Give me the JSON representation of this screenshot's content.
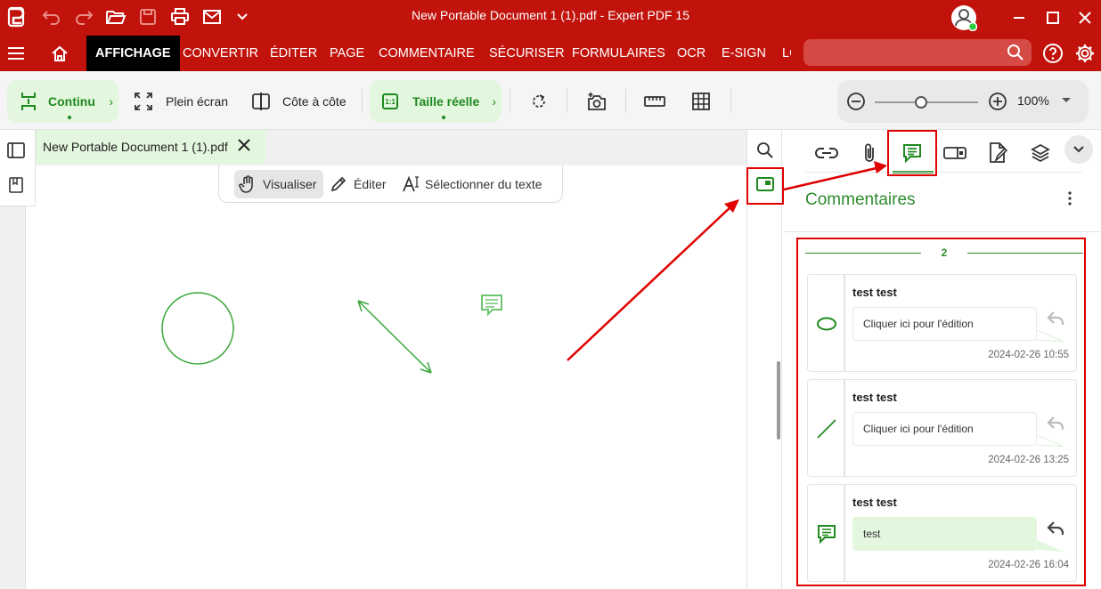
{
  "app": {
    "window_title": "New Portable Document 1 (1).pdf   -   Expert PDF 15"
  },
  "menu": {
    "items": [
      "AFFICHAGE",
      "CONVERTIR",
      "ÉDITER",
      "PAGE",
      "COMMENTAIRE",
      "SÉCURISER",
      "FORMULAIRES",
      "OCR",
      "E-SIGN",
      "LO"
    ],
    "active": "AFFICHAGE"
  },
  "toolbar": {
    "continu": "Continu",
    "plein_ecran": "Plein écran",
    "cote_a_cote": "Côte à côte",
    "taille_reelle": "Taille réelle",
    "taille_icon_text": "1:1",
    "zoom": "100%",
    "zoom_level": 0.45
  },
  "document": {
    "tab_title": "New Portable Document 1 (1).pdf",
    "modes": {
      "visualiser": "Visualiser",
      "editer": "Éditer",
      "selectionner": "Sélectionner du texte"
    }
  },
  "panel": {
    "title": "Commentaires",
    "count": "2",
    "comments": [
      {
        "author": "test test",
        "text": "Cliquer ici pour l'édition",
        "date": "2024-02-26 10:55",
        "type": "ellipse-icon"
      },
      {
        "author": "test test",
        "text": "Cliquer ici pour l'édition",
        "date": "2024-02-26 13:25",
        "type": "line-icon"
      },
      {
        "author": "test test",
        "text": "test",
        "date": "2024-02-26 16:04",
        "type": "note-icon"
      }
    ]
  },
  "colors": {
    "brand_red": "#c1120c",
    "accent_green": "#2e8b2e",
    "highlight_green": "#e3f6de",
    "annotation_red": "#e00000"
  }
}
